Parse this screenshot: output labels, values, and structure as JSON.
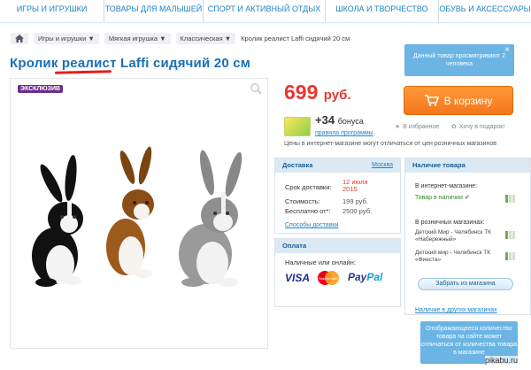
{
  "nav": {
    "items": [
      {
        "label": "ИГРЫ И ИГРУШКИ"
      },
      {
        "label": "ТОВАРЫ ДЛЯ МАЛЫШЕЙ"
      },
      {
        "label": "СПОРТ И АКТИВНЫЙ ОТДЫХ"
      },
      {
        "label": "ШКОЛА И ТВОРЧЕСТВО"
      },
      {
        "label": "ОБУВЬ И АКСЕССУАРЫ"
      }
    ]
  },
  "breadcrumb": {
    "items": [
      "Игры и игрушки ▼",
      "Мягкая игрушка ▼",
      "Классическая ▼"
    ],
    "current": "Кролик реалист Laffi сидячий 20 см"
  },
  "product": {
    "title": "Кролик реалист Laffi сидячий 20 см",
    "badge": "ЭКСКЛЮЗИВ",
    "price": "699",
    "currency": "руб.",
    "cart_label": "В корзину",
    "bonus": "+34",
    "bonus_word": "бонуса",
    "bonus_link": "правила программы",
    "wishlist": "В избранное",
    "gift": "Хочу в подарок!",
    "disclaimer": "Цены в интернет-магазине могут отличаться от цен розничных магазинов"
  },
  "viewed_notice": "Данный товар просматривают 2 человека",
  "delivery": {
    "header": "Доставка",
    "city": "Москва",
    "term_label": "Срок доставки:",
    "term_value": "12 июля 2015",
    "cost_label": "Стоимость:",
    "cost_value": "199 руб.",
    "free_label": "Бесплатно от*:",
    "free_value": "2500 руб.",
    "methods_link": "Способы доставки"
  },
  "payment": {
    "header": "Оплата",
    "text": "Наличные или онлайн:",
    "visa": "VISA",
    "mastercard": "MasterCard",
    "paypal_a": "Pay",
    "paypal_b": "Pal"
  },
  "stock": {
    "header": "Наличие товара",
    "online_label": "В интернет-магазине:",
    "online_status": "Товар в наличии",
    "online_level": 0.33,
    "retail_label": "В розничных магазинах:",
    "stores": [
      {
        "name": "Детский Мир - Челябинск ТК «Набережный»",
        "level": 0.33
      },
      {
        "name": "Детский мир - Челябинск ТК «Фиеста»",
        "level": 0.33
      }
    ],
    "pickup_button": "Забрать из магазина",
    "other_link": "Наличие в других магазинах"
  },
  "footnote": "Отображающееся количество товара на сайте может отличаться от количества товара в магазине",
  "watermark": "pikabu.ru",
  "colors": {
    "brand_blue": "#1a6fb5",
    "price_red": "#e8382e",
    "cart_orange": "#f5761a",
    "accent_purple": "#6b2d8f"
  }
}
